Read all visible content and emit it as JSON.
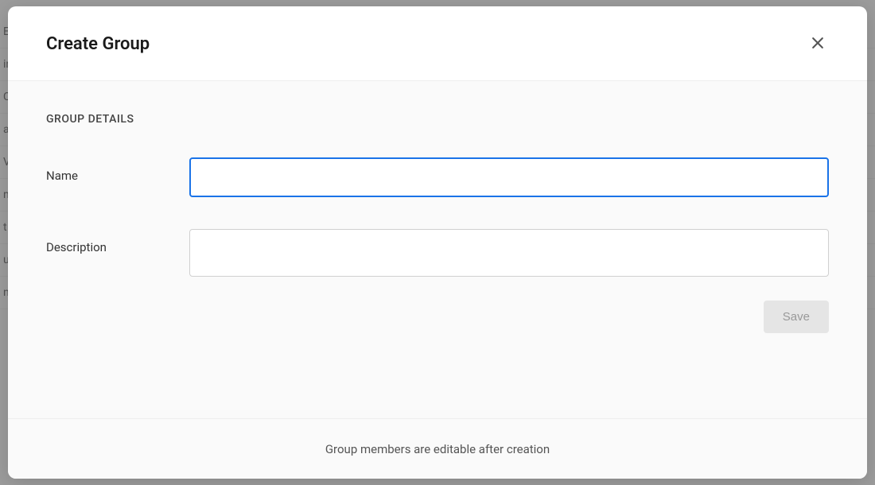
{
  "modal": {
    "title": "Create Group",
    "section_heading": "GROUP DETAILS",
    "fields": {
      "name": {
        "label": "Name",
        "value": ""
      },
      "description": {
        "label": "Description",
        "value": ""
      }
    },
    "save_button_label": "Save",
    "footer_text": "Group members are editable after creation"
  },
  "background": {
    "rows": [
      "E",
      "ir",
      "C",
      "a",
      "V",
      "n",
      "t",
      "u",
      "n"
    ]
  }
}
